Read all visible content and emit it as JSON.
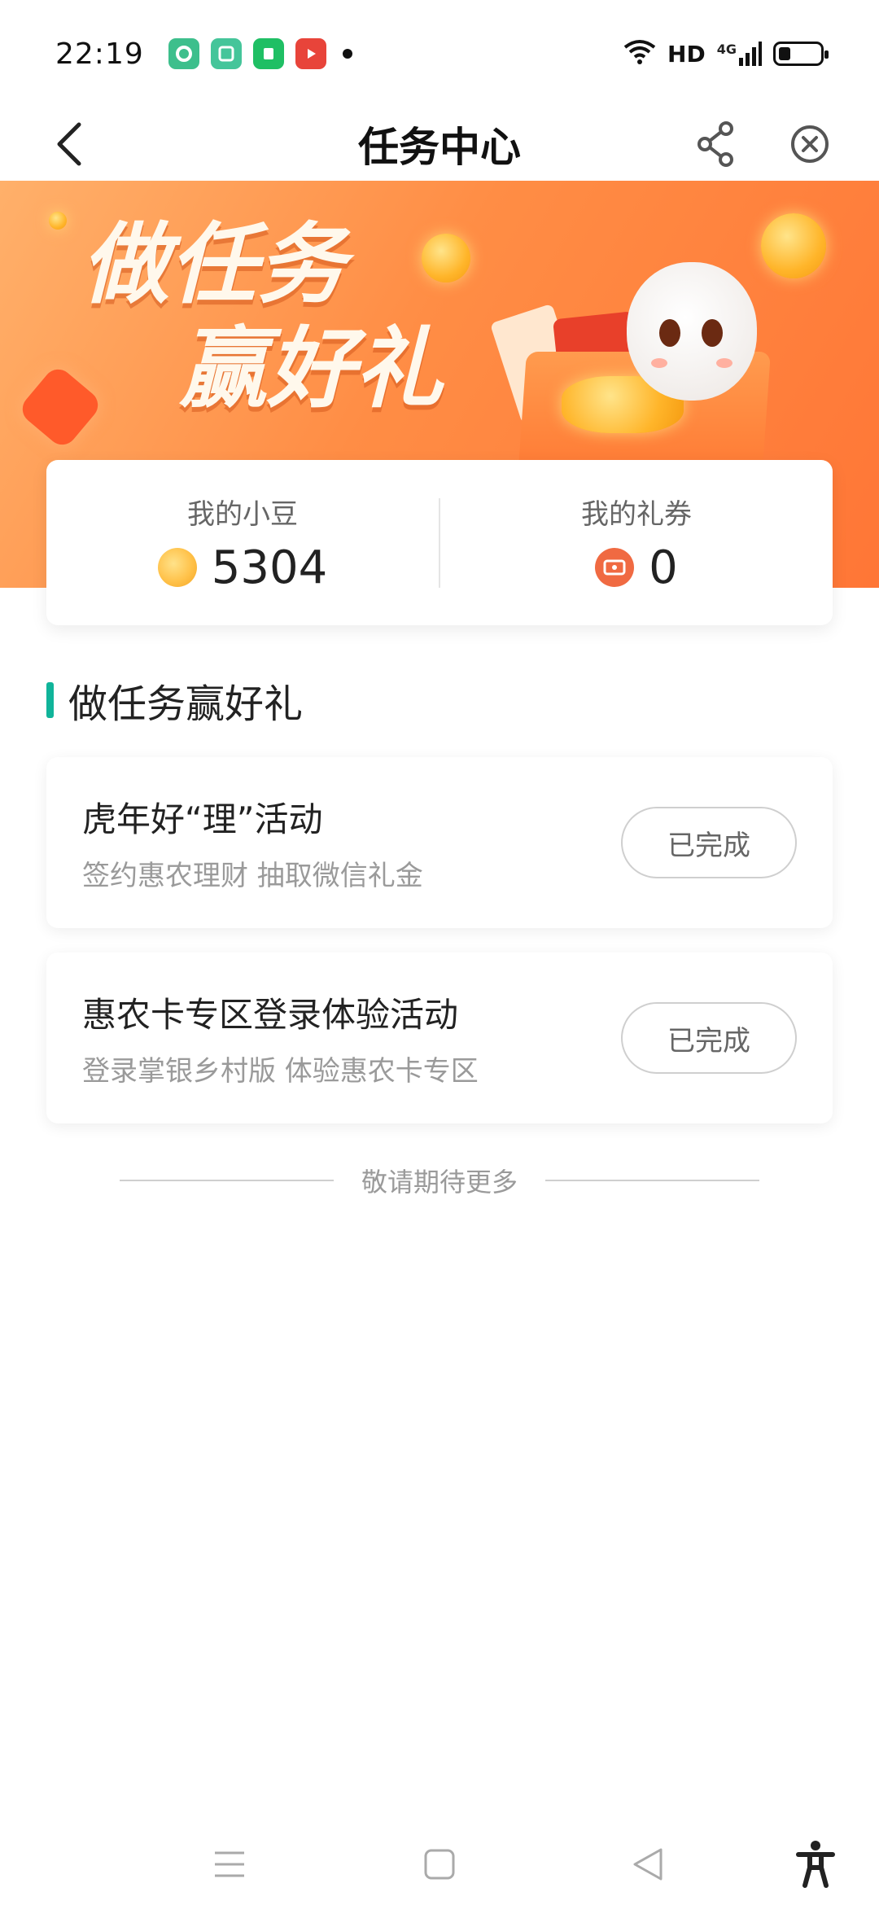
{
  "status_bar": {
    "time": "22:19",
    "network_label": "HD",
    "signal_label": "4G",
    "icons": [
      "wifi-icon",
      "hd-icon",
      "signal-icon",
      "battery-icon"
    ],
    "app_icons": [
      {
        "name": "app-notification-green-icon",
        "color": "#3dbf8c"
      },
      {
        "name": "app-notification-teal-icon",
        "color": "#45c59a"
      },
      {
        "name": "app-notification-green2-icon",
        "color": "#1fbf64"
      },
      {
        "name": "app-notification-red-icon",
        "color": "#e8443a"
      }
    ]
  },
  "nav": {
    "title": "任务中心",
    "back_icon": "chevron-left-icon",
    "share_icon": "share-icon",
    "close_icon": "close-circle-icon"
  },
  "banner": {
    "slogan_line1": "做任务",
    "slogan_line2": "赢好礼"
  },
  "stats": {
    "beans_label": "我的小豆",
    "beans_value": "5304",
    "coupons_label": "我的礼券",
    "coupons_value": "0"
  },
  "section": {
    "title": "做任务赢好礼"
  },
  "tasks": [
    {
      "title": "虎年好“理”活动",
      "description": "签约惠农理财 抽取微信礼金",
      "button_label": "已完成"
    },
    {
      "title": "惠农卡专区登录体验活动",
      "description": "登录掌银乡村版 体验惠农卡专区",
      "button_label": "已完成"
    }
  ],
  "more_hint": "敬请期待更多",
  "colors": {
    "accent": "#10b49a",
    "banner_orange": "#ff8d45"
  }
}
